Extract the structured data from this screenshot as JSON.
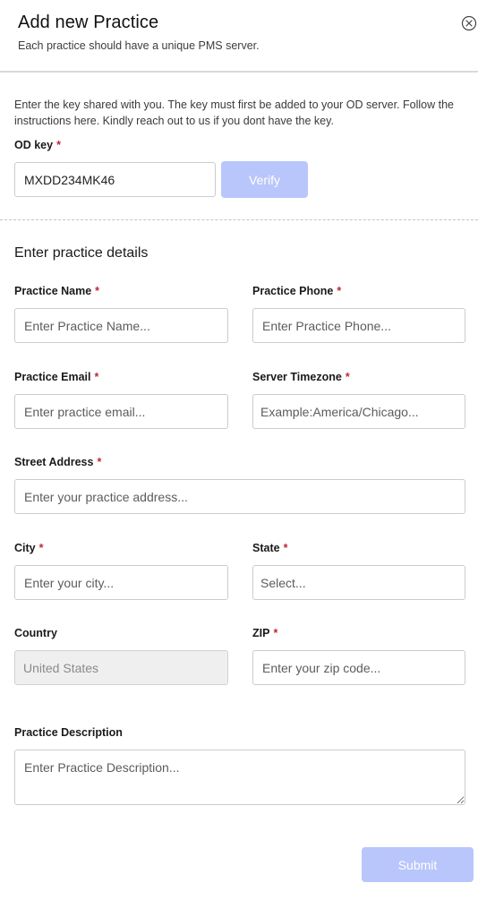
{
  "modal": {
    "title": "Add new Practice",
    "subtitle": "Each practice should have a unique PMS server."
  },
  "verify_section": {
    "instructions": "Enter the key shared with you. The key must first be added to your OD server. Follow the instructions here. Kindly reach out to us if you dont have the key.",
    "od_key_label": "OD key",
    "od_key_value": "MXDD234MK46",
    "verify_label": "Verify"
  },
  "details": {
    "section_title": "Enter practice details",
    "practice_name": {
      "label": "Practice Name",
      "placeholder": "Enter Practice Name..."
    },
    "practice_phone": {
      "label": "Practice Phone",
      "placeholder": "Enter Practice Phone..."
    },
    "practice_email": {
      "label": "Practice Email",
      "placeholder": "Enter practice email..."
    },
    "server_timezone": {
      "label": "Server Timezone",
      "placeholder": "Example:America/Chicago..."
    },
    "street_address": {
      "label": "Street Address",
      "placeholder": "Enter your practice address..."
    },
    "city": {
      "label": "City",
      "placeholder": "Enter your city..."
    },
    "state": {
      "label": "State",
      "placeholder": "Select..."
    },
    "country": {
      "label": "Country",
      "value": "United States"
    },
    "zip": {
      "label": "ZIP",
      "placeholder": "Enter your zip code..."
    },
    "description": {
      "label": "Practice Description",
      "placeholder": "Enter Practice Description..."
    }
  },
  "required_marker": "*",
  "submit_label": "Submit",
  "colors": {
    "button_disabled": "#b9c6fb",
    "required": "#c0263a"
  },
  "icons": {
    "close": "circle-x-icon",
    "resize": "resize-handle-icon"
  }
}
